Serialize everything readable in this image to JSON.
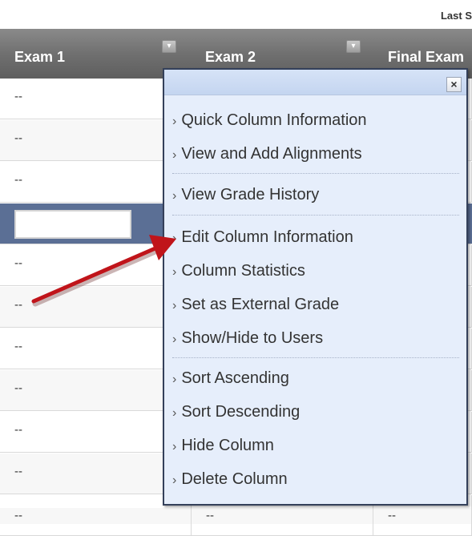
{
  "top": {
    "last_saved_label": "Last S"
  },
  "columns": [
    {
      "label": "Exam 1"
    },
    {
      "label": "Exam 2"
    },
    {
      "label": "Final Exam"
    }
  ],
  "icons": {
    "column_menu": "chevron-down-icon",
    "close": "close-icon"
  },
  "rows": [
    {
      "c1": "--",
      "c2": "",
      "c3": ""
    },
    {
      "c1": "--",
      "c2": "",
      "c3": ""
    },
    {
      "c1": "--",
      "c2": "",
      "c3": ""
    },
    {
      "c1": "",
      "c2": "",
      "c3": ""
    },
    {
      "c1": "--",
      "c2": "",
      "c3": ""
    },
    {
      "c1": "--",
      "c2": "",
      "c3": ""
    },
    {
      "c1": "--",
      "c2": "",
      "c3": ""
    },
    {
      "c1": "--",
      "c2": "",
      "c3": ""
    },
    {
      "c1": "--",
      "c2": "",
      "c3": ""
    },
    {
      "c1": "--",
      "c2": "",
      "c3": ""
    },
    {
      "c1": "--",
      "c2": "",
      "c3": ""
    },
    {
      "c1": "--",
      "c2": "--",
      "c3": "--"
    }
  ],
  "grade_input": {
    "value": ""
  },
  "popup": {
    "close_label": "×",
    "groups": [
      {
        "items": [
          "Quick Column Information",
          "View and Add Alignments"
        ]
      },
      {
        "items": [
          "View Grade History"
        ]
      },
      {
        "items": [
          "Edit Column Information",
          "Column Statistics",
          "Set as External Grade",
          "Show/Hide to Users"
        ]
      },
      {
        "items": [
          "Sort Ascending",
          "Sort Descending",
          "Hide Column",
          "Delete Column"
        ]
      }
    ],
    "chevron": "›"
  },
  "annotation": {
    "color": "#c0141a"
  },
  "colors": {
    "header": "#707070",
    "selected_row": "#5b6f95",
    "popup_bg": "#e6eefb"
  }
}
